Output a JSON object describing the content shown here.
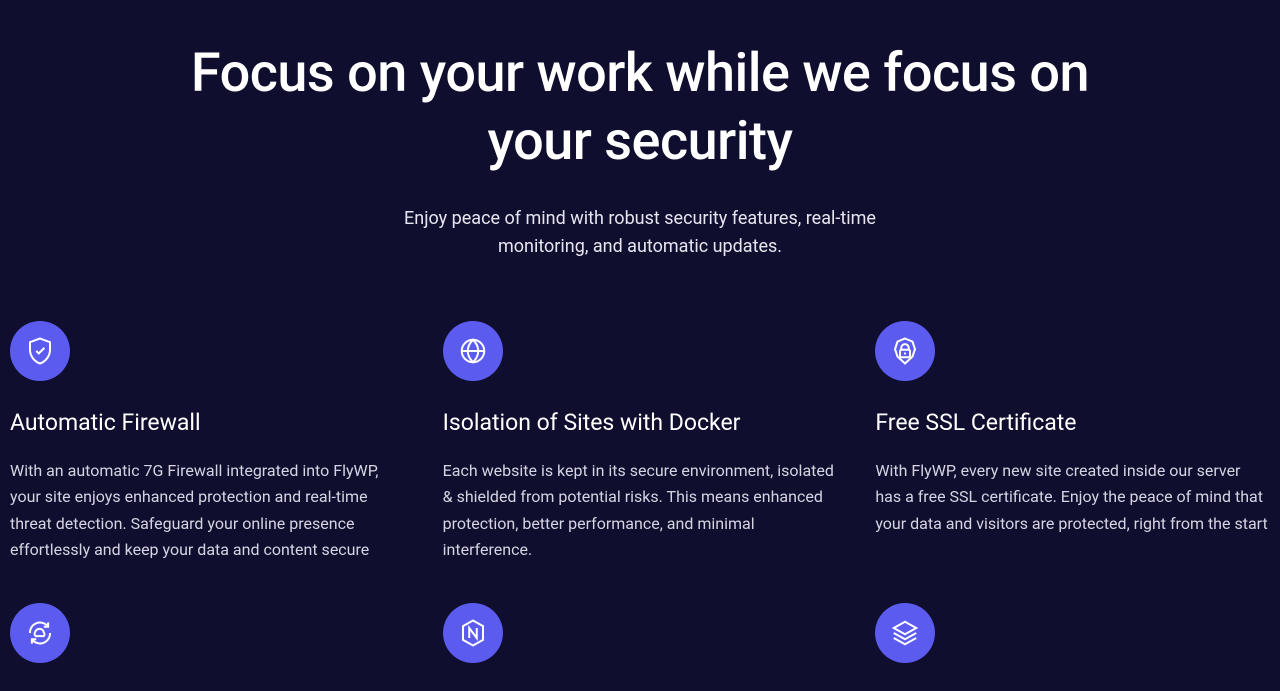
{
  "hero": {
    "title": "Focus on your work while we focus on your security",
    "subtitle": "Enjoy peace of mind with robust security features, real-time monitoring, and automatic updates."
  },
  "features": [
    {
      "icon": "shield-check",
      "title": "Automatic Firewall",
      "body": "With an automatic 7G Firewall integrated into FlyWP, your site enjoys enhanced protection and real-time threat detection. Safeguard your online presence effortlessly and keep your data and content secure"
    },
    {
      "icon": "globe",
      "title": "Isolation of Sites with Docker",
      "body": "Each website is kept in its secure environment, isolated & shielded from potential risks. This means enhanced protection, better performance, and minimal interference."
    },
    {
      "icon": "lock-star",
      "title": "Free SSL Certificate",
      "body": "With FlyWP, every new site created inside our server has a free SSL certificate. Enjoy the peace of mind that your data and visitors are protected, right from the start"
    },
    {
      "icon": "cloud-refresh",
      "title": "",
      "body": ""
    },
    {
      "icon": "hex-n",
      "title": "",
      "body": ""
    },
    {
      "icon": "layers",
      "title": "",
      "body": ""
    }
  ]
}
